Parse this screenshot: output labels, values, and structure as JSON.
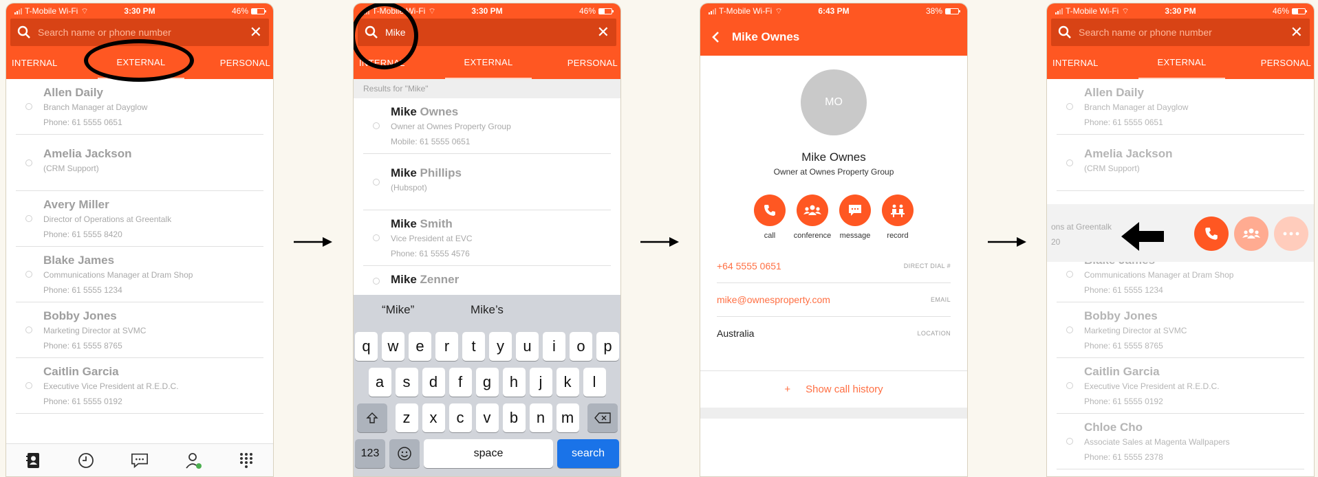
{
  "status": {
    "carrier": "T-Mobile Wi-Fi",
    "time_a": "3:30 PM",
    "time_c": "6:43 PM",
    "battery_a": "46%",
    "battery_c": "38%"
  },
  "search": {
    "placeholder": "Search name or phone number",
    "value": "Mike"
  },
  "tabs": [
    "INTERNAL",
    "EXTERNAL",
    "PERSONAL"
  ],
  "contacts": [
    {
      "name": "Allen Daily",
      "title": "Branch Manager at Dayglow",
      "phone": "Phone: 61 5555 0651"
    },
    {
      "name": "Amelia Jackson",
      "title": "(CRM Support)",
      "phone": ""
    },
    {
      "name": "Avery Miller",
      "title": "Director of Operations at Greentalk",
      "phone": "Phone: 61 5555 8420"
    },
    {
      "name": "Blake James",
      "title": "Communications Manager at Dram Shop",
      "phone": "Phone: 61 5555 1234"
    },
    {
      "name": "Bobby Jones",
      "title": "Marketing Director at SVMC",
      "phone": "Phone: 61 5555 8765"
    },
    {
      "name": "Caitlin Garcia",
      "title": "Executive Vice President at R.E.D.C.",
      "phone": "Phone: 61 5555 0192"
    },
    {
      "name": "Chloe Cho",
      "title": "Associate Sales at Magenta Wallpapers",
      "phone": "Phone: 61 5555 2378"
    }
  ],
  "results": {
    "header": "Results for \"Mike\"",
    "match": "Mike",
    "items": [
      {
        "rest": " Ownes",
        "title": "Owner at Ownes Property Group",
        "phone": "Mobile: 61 5555 0651"
      },
      {
        "rest": " Phillips",
        "title": "(Hubspot)",
        "phone": ""
      },
      {
        "rest": " Smith",
        "title": "Vice President at EVC",
        "phone": "Phone: 61 5555 4576"
      },
      {
        "rest": " Zenner",
        "title": "",
        "phone": ""
      }
    ]
  },
  "keyboard": {
    "suggestions": [
      "“Mike”",
      "Mike’s"
    ],
    "row1": [
      "q",
      "w",
      "e",
      "r",
      "t",
      "y",
      "u",
      "i",
      "o",
      "p"
    ],
    "row2": [
      "a",
      "s",
      "d",
      "f",
      "g",
      "h",
      "j",
      "k",
      "l"
    ],
    "row3": [
      "z",
      "x",
      "c",
      "v",
      "b",
      "n",
      "m"
    ],
    "numbers_label": "123",
    "space_label": "space",
    "search_label": "search"
  },
  "detail": {
    "header_name": "Mike Ownes",
    "initials": "MO",
    "name": "Mike Ownes",
    "title": "Owner at Ownes Property Group",
    "actions": [
      "call",
      "conference",
      "message",
      "record"
    ],
    "phone": "+64 5555 0651",
    "phone_type": "DIRECT DIAL #",
    "email": "mike@ownesproperty.com",
    "email_type": "EMAIL",
    "location": "Australia",
    "location_type": "LOCATION",
    "history_plus": "+",
    "history": "Show call history"
  },
  "swipe": {
    "partial_title": "ons at Greentalk",
    "partial_phone": "20"
  },
  "colors": {
    "brand": "#ff5722",
    "brand_dark": "#d84315",
    "ios_blue": "#1a73e8"
  }
}
